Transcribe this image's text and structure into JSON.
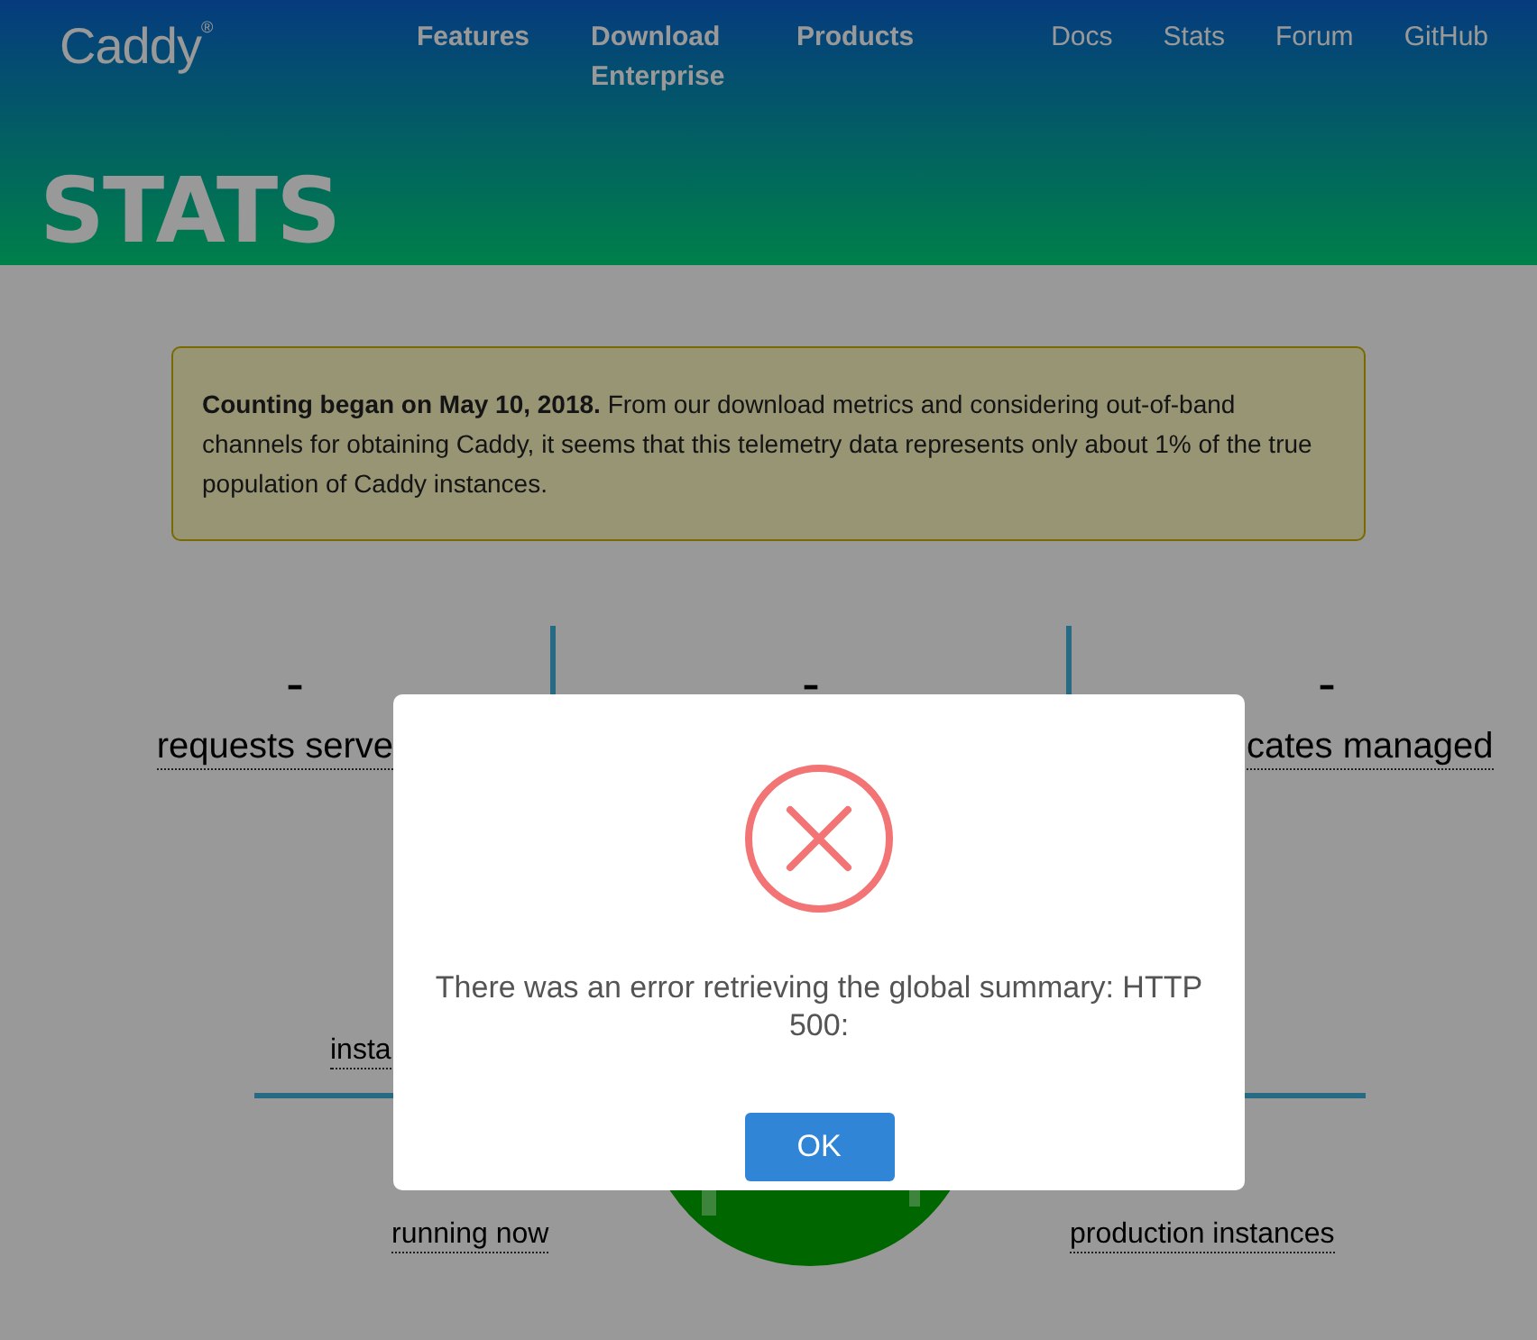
{
  "header": {
    "logo": "Caddy$^{®}$",
    "nav": [
      "Features",
      "Download Enterprise",
      "Products"
    ],
    "nav_right": [
      "Docs",
      "Stats",
      "Forum",
      "GitHub"
    ],
    "title": "STATS"
  },
  "notice": {
    "text": "**Counting began on May 10, 2018.** From our download metrics and considering out-of-band channels for obtaining Caddy, it seems that this telemetry data represents only about 1% of the true population of Caddy instances."
  },
  "stats": [
    {
      "value": "-",
      "label": "requests serve"
    },
    {
      "value": "-"
    },
    {
      "value": "-",
      "label": "cates managed"
    }
  ],
  "instances": {
    "label": "insta",
    "left_label": "running now",
    "right_label": "production instances"
  },
  "dialog": {
    "kind": "error",
    "message": "There was an error retrieving the global summary: HTTP 500:",
    "button": "OK"
  }
}
